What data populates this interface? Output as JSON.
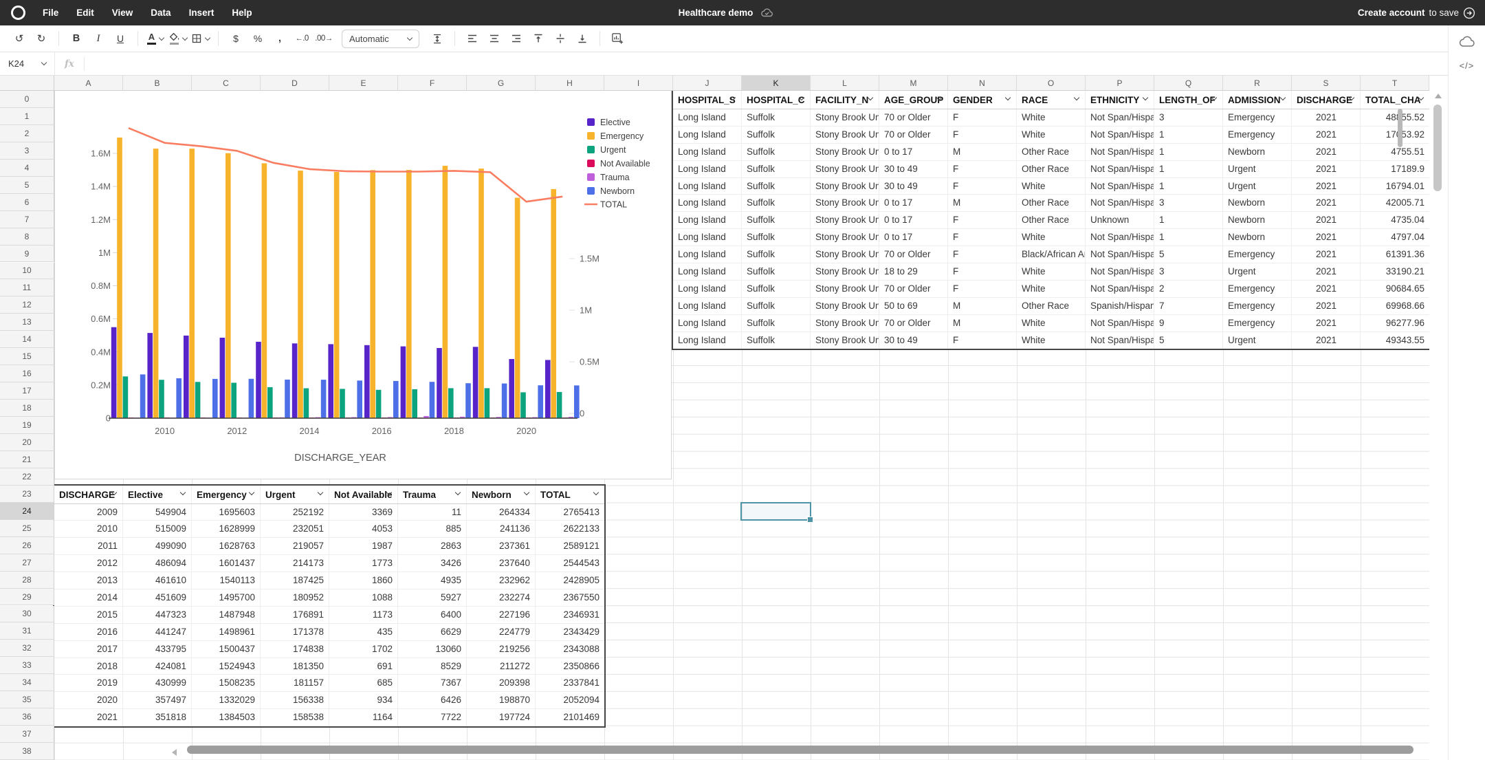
{
  "colors": {
    "accent_teal": "#4E93A6",
    "menubar_bg": "#2D2D2E",
    "total_line": "#F97E61"
  },
  "menu_bar": {
    "menus": [
      "File",
      "Edit",
      "View",
      "Data",
      "Insert",
      "Help"
    ],
    "doc_title": "Healthcare demo",
    "create_account": "Create account",
    "to_save": "to save"
  },
  "toolbar": {
    "undo": "↺",
    "redo": "↻",
    "bold": "B",
    "italic": "I",
    "underline": "U",
    "text_color": "A",
    "currency": "$",
    "percent": "%",
    "comma": ",",
    "decrease_decimal": "←.0",
    "increase_decimal": ".00→",
    "format_mode": "Automatic"
  },
  "formula_bar": {
    "cell_ref": "K24",
    "fx": "fx",
    "value": ""
  },
  "side_panel": {
    "code_label": "</>"
  },
  "sheet": {
    "columns": [
      "A",
      "B",
      "C",
      "D",
      "E",
      "F",
      "G",
      "H",
      "I",
      "J",
      "K",
      "L",
      "M",
      "N",
      "O",
      "P",
      "Q",
      "R",
      "S",
      "T"
    ],
    "rows": [
      "0",
      "1",
      "2",
      "3",
      "4",
      "5",
      "6",
      "7",
      "8",
      "9",
      "10",
      "11",
      "12",
      "13",
      "14",
      "15",
      "16",
      "17",
      "18",
      "19",
      "20",
      "21",
      "22",
      "23",
      "24",
      "25",
      "26",
      "27",
      "28",
      "29",
      "30",
      "31",
      "32",
      "33",
      "34",
      "35",
      "36",
      "37",
      "38"
    ],
    "selected_cell": "K24",
    "selected_column": "K",
    "selected_row": "24"
  },
  "chart_data": {
    "type": "bar+line",
    "x": [
      2009,
      2010,
      2011,
      2012,
      2013,
      2014,
      2015,
      2016,
      2017,
      2018,
      2019,
      2020,
      2021
    ],
    "series": [
      {
        "name": "Elective",
        "color": "#5724C9",
        "values": [
          549904,
          515009,
          499090,
          486094,
          461610,
          451609,
          447323,
          441247,
          433795,
          424081,
          430999,
          357497,
          351818
        ]
      },
      {
        "name": "Emergency",
        "color": "#F7B32B",
        "values": [
          1695603,
          1628999,
          1628763,
          1601437,
          1540113,
          1495700,
          1487948,
          1498961,
          1500437,
          1524943,
          1508235,
          1332029,
          1384503
        ]
      },
      {
        "name": "Urgent",
        "color": "#0BA47E",
        "values": [
          252192,
          232051,
          219057,
          214173,
          187425,
          180952,
          176891,
          171378,
          174838,
          181350,
          181157,
          156338,
          158538
        ]
      },
      {
        "name": "Not Available",
        "color": "#DB0A5B",
        "values": [
          3369,
          4053,
          1987,
          1773,
          1860,
          1088,
          1173,
          435,
          1702,
          691,
          685,
          934,
          1164
        ]
      },
      {
        "name": "Trauma",
        "color": "#C05FDB",
        "values": [
          11,
          885,
          2863,
          3426,
          4935,
          5927,
          6400,
          6629,
          13060,
          8529,
          7367,
          6426,
          7722
        ]
      },
      {
        "name": "Newborn",
        "color": "#4D6FE8",
        "values": [
          264334,
          241136,
          237361,
          237640,
          232962,
          232274,
          227196,
          224779,
          219256,
          211272,
          209398,
          198870,
          197724
        ]
      }
    ],
    "line_series": {
      "name": "TOTAL",
      "color": "#F97E61",
      "values": [
        2765413,
        2622133,
        2589121,
        2544543,
        2428905,
        2367550,
        2346931,
        2343429,
        2343088,
        2350866,
        2337841,
        2052094,
        2101469
      ]
    },
    "xlabel": "DISCHARGE_YEAR",
    "left_axis_ticks": [
      "0",
      "0.2M",
      "0.4M",
      "0.6M",
      "0.8M",
      "1M",
      "1.2M",
      "1.4M",
      "1.6M"
    ],
    "right_axis_ticks": [
      "0",
      "0.5M",
      "1M",
      "1.5M"
    ],
    "x_tick_labels": [
      "2010",
      "2012",
      "2014",
      "2016",
      "2018",
      "2020"
    ],
    "left_axis_max": 1600000,
    "right_axis_max": 1500000,
    "grid": false,
    "legend_position": "right"
  },
  "right_table": {
    "headers": [
      "HOSPITAL_S",
      "HOSPITAL_C",
      "FACILITY_N",
      "AGE_GROUP",
      "GENDER",
      "RACE",
      "ETHNICITY",
      "LENGTH_OF",
      "ADMISSION",
      "DISCHARGE",
      "TOTAL_CHA"
    ],
    "rows": [
      [
        "Long Island",
        "Suffolk",
        "Stony Brook Uni",
        "70 or Older",
        "F",
        "White",
        "Not Span/Hispa",
        "3",
        "Emergency",
        "2021",
        "48855.52"
      ],
      [
        "Long Island",
        "Suffolk",
        "Stony Brook Uni",
        "70 or Older",
        "F",
        "White",
        "Not Span/Hispa",
        "1",
        "Emergency",
        "2021",
        "17053.92"
      ],
      [
        "Long Island",
        "Suffolk",
        "Stony Brook Uni",
        "0 to 17",
        "M",
        "Other Race",
        "Not Span/Hispa",
        "1",
        "Newborn",
        "2021",
        "4755.51"
      ],
      [
        "Long Island",
        "Suffolk",
        "Stony Brook Uni",
        "30 to 49",
        "F",
        "Other Race",
        "Not Span/Hispa",
        "1",
        "Urgent",
        "2021",
        "17189.9"
      ],
      [
        "Long Island",
        "Suffolk",
        "Stony Brook Uni",
        "30 to 49",
        "F",
        "White",
        "Not Span/Hispa",
        "1",
        "Urgent",
        "2021",
        "16794.01"
      ],
      [
        "Long Island",
        "Suffolk",
        "Stony Brook Uni",
        "0 to 17",
        "M",
        "Other Race",
        "Not Span/Hispa",
        "3",
        "Newborn",
        "2021",
        "42005.71"
      ],
      [
        "Long Island",
        "Suffolk",
        "Stony Brook Uni",
        "0 to 17",
        "F",
        "Other Race",
        "Unknown",
        "1",
        "Newborn",
        "2021",
        "4735.04"
      ],
      [
        "Long Island",
        "Suffolk",
        "Stony Brook Uni",
        "0 to 17",
        "F",
        "White",
        "Not Span/Hispa",
        "1",
        "Newborn",
        "2021",
        "4797.04"
      ],
      [
        "Long Island",
        "Suffolk",
        "Stony Brook Uni",
        "70 or Older",
        "F",
        "Black/African Am",
        "Not Span/Hispa",
        "5",
        "Emergency",
        "2021",
        "61391.36"
      ],
      [
        "Long Island",
        "Suffolk",
        "Stony Brook Uni",
        "18 to 29",
        "F",
        "White",
        "Not Span/Hispa",
        "3",
        "Urgent",
        "2021",
        "33190.21"
      ],
      [
        "Long Island",
        "Suffolk",
        "Stony Brook Uni",
        "70 or Older",
        "F",
        "White",
        "Not Span/Hispa",
        "2",
        "Emergency",
        "2021",
        "90684.65"
      ],
      [
        "Long Island",
        "Suffolk",
        "Stony Brook Uni",
        "50 to 69",
        "M",
        "Other Race",
        "Spanish/Hispan",
        "7",
        "Emergency",
        "2021",
        "69968.66"
      ],
      [
        "Long Island",
        "Suffolk",
        "Stony Brook Uni",
        "70 or Older",
        "M",
        "White",
        "Not Span/Hispa",
        "9",
        "Emergency",
        "2021",
        "96277.96"
      ],
      [
        "Long Island",
        "Suffolk",
        "Stony Brook Uni",
        "30 to 49",
        "F",
        "White",
        "Not Span/Hispa",
        "5",
        "Urgent",
        "2021",
        "49343.55"
      ]
    ]
  },
  "bottom_table": {
    "headers": [
      "DISCHARGE",
      "Elective",
      "Emergency",
      "Urgent",
      "Not Available",
      "Trauma",
      "Newborn",
      "TOTAL"
    ],
    "rows": [
      [
        "2009",
        "549904",
        "1695603",
        "252192",
        "3369",
        "11",
        "264334",
        "2765413"
      ],
      [
        "2010",
        "515009",
        "1628999",
        "232051",
        "4053",
        "885",
        "241136",
        "2622133"
      ],
      [
        "2011",
        "499090",
        "1628763",
        "219057",
        "1987",
        "2863",
        "237361",
        "2589121"
      ],
      [
        "2012",
        "486094",
        "1601437",
        "214173",
        "1773",
        "3426",
        "237640",
        "2544543"
      ],
      [
        "2013",
        "461610",
        "1540113",
        "187425",
        "1860",
        "4935",
        "232962",
        "2428905"
      ],
      [
        "2014",
        "451609",
        "1495700",
        "180952",
        "1088",
        "5927",
        "232274",
        "2367550"
      ],
      [
        "2015",
        "447323",
        "1487948",
        "176891",
        "1173",
        "6400",
        "227196",
        "2346931"
      ],
      [
        "2016",
        "441247",
        "1498961",
        "171378",
        "435",
        "6629",
        "224779",
        "2343429"
      ],
      [
        "2017",
        "433795",
        "1500437",
        "174838",
        "1702",
        "13060",
        "219256",
        "2343088"
      ],
      [
        "2018",
        "424081",
        "1524943",
        "181350",
        "691",
        "8529",
        "211272",
        "2350866"
      ],
      [
        "2019",
        "430999",
        "1508235",
        "181157",
        "685",
        "7367",
        "209398",
        "2337841"
      ],
      [
        "2020",
        "357497",
        "1332029",
        "156338",
        "934",
        "6426",
        "198870",
        "2052094"
      ],
      [
        "2021",
        "351818",
        "1384503",
        "158538",
        "1164",
        "7722",
        "197724",
        "2101469"
      ]
    ]
  }
}
